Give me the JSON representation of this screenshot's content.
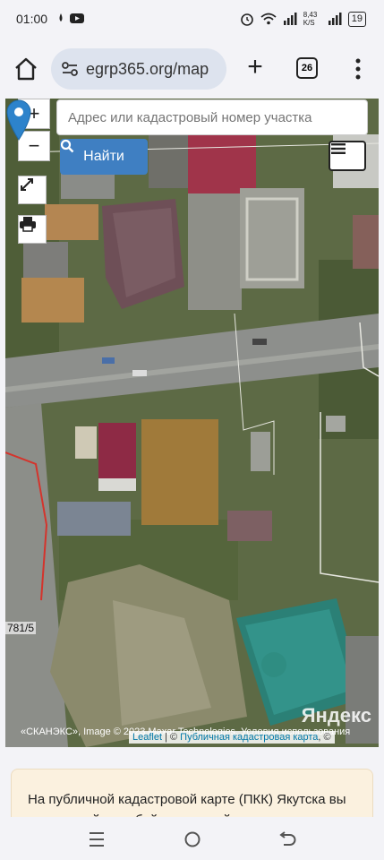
{
  "status": {
    "time": "01:00",
    "net_speed": "8,43 K/S",
    "battery": "19"
  },
  "browser": {
    "url": "egrp365.org/map",
    "tab_count": "26"
  },
  "map": {
    "search_placeholder": "Адрес или кадастровый номер участка",
    "find_label": "Найти",
    "zoom_in": "+",
    "zoom_out": "−",
    "parcel_label": "781/5",
    "yandex_logo": "Яндекс",
    "attribution_left": "«СКАНЭКС», Image © 2023 Maxar Technologies. Условия использования",
    "attribution_leaflet": "Leaflet",
    "attribution_sep": " | © ",
    "attribution_pkk": "Публичная кадастровая карта",
    "attribution_end": ", ©"
  },
  "info": {
    "text": "На публичной кадастровой карте (ПКК) Якутска вы можете найти любой земельный участок"
  },
  "colors": {
    "accent_blue": "#3f7fc2",
    "marker": "#2d83cb",
    "card_bg": "#fbf1df"
  }
}
